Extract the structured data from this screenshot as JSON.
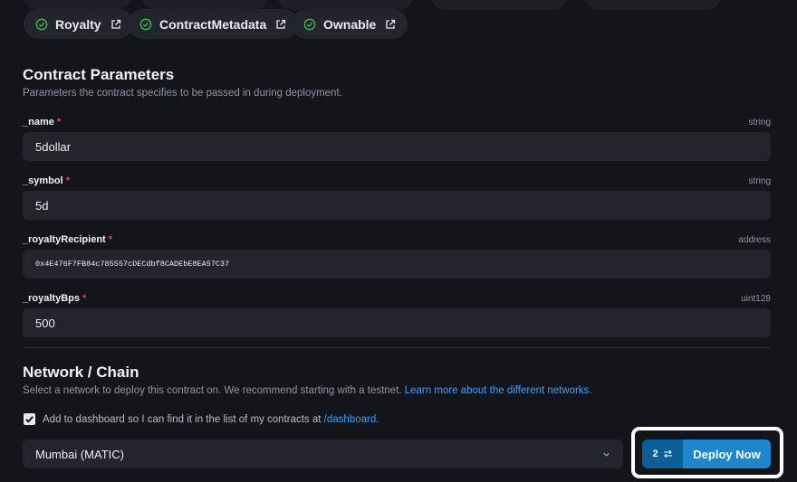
{
  "extensions": [
    {
      "label": "Royalty"
    },
    {
      "label": "ContractMetadata"
    },
    {
      "label": "Ownable"
    }
  ],
  "params": {
    "title": "Contract Parameters",
    "subtitle": "Parameters the contract specifies to be passed in during deployment.",
    "fields": [
      {
        "name": "_name",
        "type": "string",
        "value": "5dollar"
      },
      {
        "name": "_symbol",
        "type": "string",
        "value": "5d"
      },
      {
        "name": "_royaltyRecipient",
        "type": "address",
        "value": "0x4E476F7FB84c785557cDECdbf8CADEbE8EA57C37"
      },
      {
        "name": "_royaltyBps",
        "type": "uint128",
        "value": "500"
      }
    ],
    "required_mark": "*"
  },
  "network": {
    "title": "Network / Chain",
    "subtitle": "Select a network to deploy this contract on. We recommend starting with a testnet.",
    "subtitle_link": "Learn more about the different networks.",
    "dashboard_label": "Add to dashboard so I can find it in the list of my contracts at",
    "dashboard_link": "/dashboard",
    "dashboard_suffix": ".",
    "dashboard_checked": true,
    "selected_chain": "Mumbai (MATIC)"
  },
  "deploy": {
    "tx_count": "2",
    "label": "Deploy Now"
  },
  "colors": {
    "accent": "#1d86cc",
    "check": "#3fb950",
    "required": "#e5484d",
    "link": "#3aa0ff"
  },
  "icons": {
    "extension_status": "check-circle-icon",
    "extension_link": "external-link-icon",
    "select_chevron": "chevron-down-icon",
    "tx_badge": "swap-arrows-icon"
  }
}
